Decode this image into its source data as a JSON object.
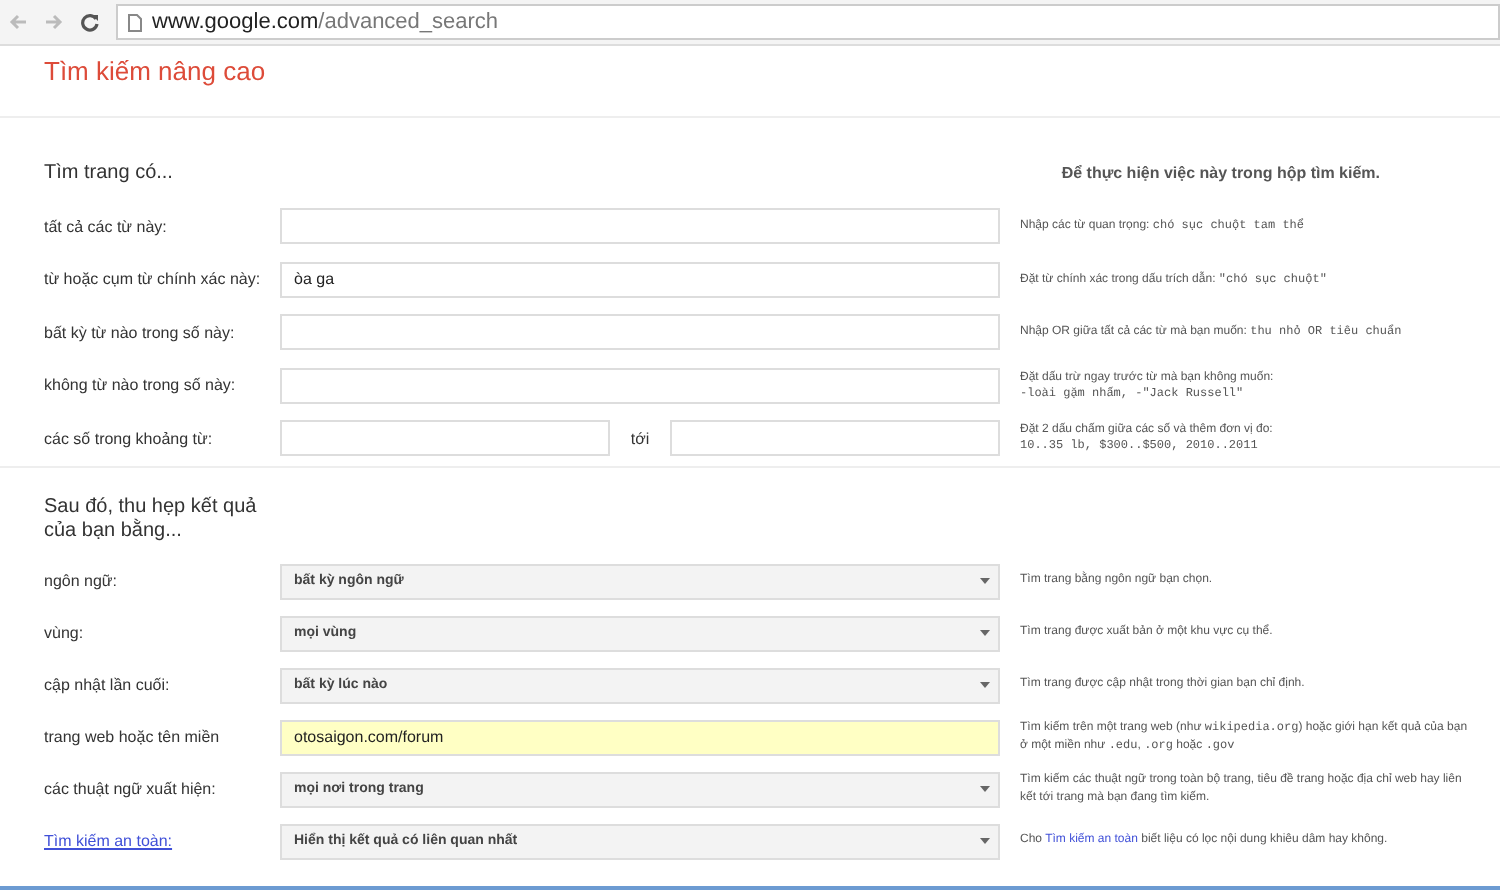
{
  "browser": {
    "url_host": "www.google.com",
    "url_path": "/advanced_search"
  },
  "title": "Tìm kiếm nâng cao",
  "section_1": {
    "heading": "Tìm trang có...",
    "hint_heading": "Để thực hiện việc này trong hộp tìm kiếm.",
    "rows": [
      {
        "kind": "text",
        "label": "tất cả các từ này:",
        "value": "",
        "hint": [
          {
            "kind": "text",
            "text": "Nhập các từ quan trọng: "
          },
          {
            "kind": "code",
            "text": "chó sục chuột tam thể"
          }
        ]
      },
      {
        "kind": "text",
        "label": "từ hoặc cụm từ chính xác này:",
        "value": "òa ga",
        "hint": [
          {
            "kind": "text",
            "text": "Đặt từ chính xác trong dấu trích dẫn: "
          },
          {
            "kind": "code",
            "text": "\"chó sục chuột\""
          }
        ]
      },
      {
        "kind": "text",
        "label": "bất kỳ từ nào trong số này:",
        "value": "",
        "hint": [
          {
            "kind": "text",
            "text": "Nhập OR giữa tất cả các từ mà bạn muốn: "
          },
          {
            "kind": "code",
            "text": "thu nhỏ OR tiêu chuẩn"
          }
        ]
      },
      {
        "kind": "text",
        "label": "không từ nào trong số này:",
        "value": "",
        "hint": [
          {
            "kind": "text",
            "text": "Đặt dấu trừ ngay trước từ mà bạn không muốn: "
          },
          {
            "kind": "code",
            "text": "-loài gặm nhấm, -\"Jack Russell\""
          }
        ]
      },
      {
        "kind": "range",
        "label": "các số trong khoảng từ:",
        "value": "",
        "to_label": "tới",
        "value_2": "",
        "hint": [
          {
            "kind": "text",
            "text": "Đặt 2 dấu chấm giữa các số và thêm đơn vị đo: "
          },
          {
            "kind": "code",
            "text": "10..35 lb, $300..$500, 2010..2011"
          }
        ]
      }
    ]
  },
  "section_2": {
    "heading": "Sau đó, thu hẹp kết quả của bạn bằng...",
    "rows": [
      {
        "kind": "select",
        "label": "ngôn ngữ:",
        "link": false,
        "value": "bất kỳ ngôn ngữ",
        "hint": [
          {
            "kind": "text",
            "text": "Tìm trang bằng ngôn ngữ bạn chọn."
          }
        ]
      },
      {
        "kind": "select",
        "label": "vùng:",
        "link": false,
        "value": "mọi vùng",
        "hint": [
          {
            "kind": "text",
            "text": "Tìm trang được xuất bản ở một khu vực cụ thể."
          }
        ]
      },
      {
        "kind": "select",
        "label": "cập nhật lần cuối:",
        "link": false,
        "value": "bất kỳ lúc nào",
        "hint": [
          {
            "kind": "text",
            "text": "Tìm trang được cập nhật trong thời gian bạn chỉ định."
          }
        ]
      },
      {
        "kind": "text",
        "label": "trang web hoặc tên miền",
        "link": false,
        "highlighted": true,
        "value": "otosaigon.com/forum",
        "hint": [
          {
            "kind": "text",
            "text": "Tìm kiếm trên một trang web (như "
          },
          {
            "kind": "code",
            "text": "wikipedia.org"
          },
          {
            "kind": "text",
            "text": ") hoặc giới hạn kết quả của bạn ở một miền như "
          },
          {
            "kind": "code",
            "text": ".edu"
          },
          {
            "kind": "text",
            "text": ", "
          },
          {
            "kind": "code",
            "text": ".org"
          },
          {
            "kind": "text",
            "text": " hoặc "
          },
          {
            "kind": "code",
            "text": ".gov"
          }
        ]
      },
      {
        "kind": "select",
        "label": "các thuật ngữ xuất hiện:",
        "link": false,
        "value": "mọi nơi trong trang",
        "hint": [
          {
            "kind": "text",
            "text": "Tìm kiếm các thuật ngữ trong toàn bộ trang, tiêu đề trang hoặc địa chỉ web hay liên kết tới trang mà bạn đang tìm kiếm."
          }
        ]
      },
      {
        "kind": "select",
        "label": "Tìm kiếm an toàn:",
        "link": true,
        "value": "Hiển thị kết quả có liên quan nhất",
        "hint": [
          {
            "kind": "text",
            "text": "Cho "
          },
          {
            "kind": "link",
            "text": "Tìm kiếm an toàn"
          },
          {
            "kind": "text",
            "text": " biết liệu có lọc nội dung khiêu dâm hay không."
          }
        ]
      }
    ]
  }
}
